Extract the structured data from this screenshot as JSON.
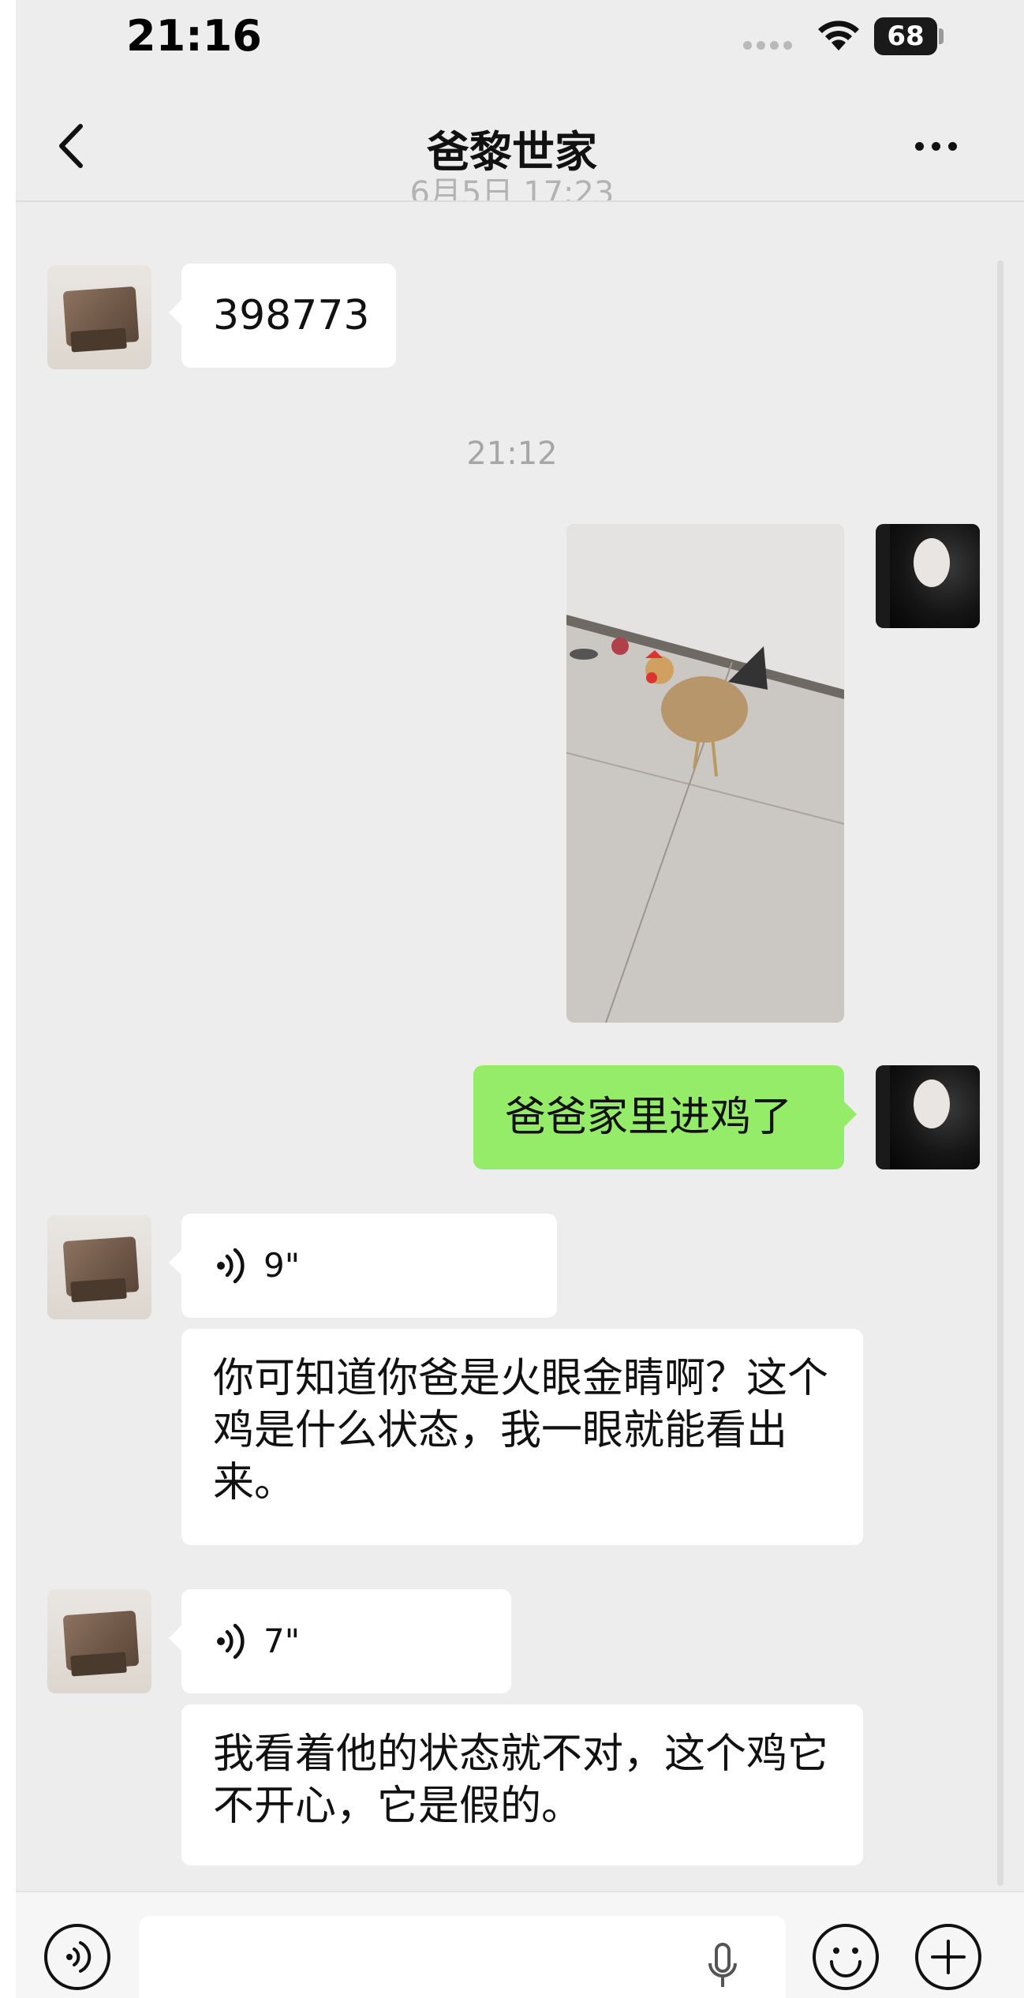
{
  "status_bar": {
    "time": "21:16",
    "battery": "68"
  },
  "nav": {
    "title": "爸黎世家",
    "cut_timestamp": "6月5日 17:23"
  },
  "messages": [
    {
      "from": "them",
      "type": "text",
      "text": "398773"
    },
    {
      "type": "timestamp",
      "text": "21:12"
    },
    {
      "from": "me",
      "type": "image"
    },
    {
      "from": "me",
      "type": "text",
      "text": "爸爸家里进鸡了"
    },
    {
      "from": "them",
      "type": "voice",
      "duration": "9\""
    },
    {
      "from": "them",
      "type": "text",
      "text": "你可知道你爸是火眼金睛啊？这个鸡是什么状态，我一眼就能看出来。"
    },
    {
      "from": "them",
      "type": "voice",
      "duration": "7\""
    },
    {
      "from": "them",
      "type": "text",
      "text": "我看着他的状态就不对，这个鸡它不开心，它是假的。"
    }
  ],
  "colors": {
    "chat_bg": "#ededed",
    "my_bubble": "#95ec69",
    "their_bubble": "#ffffff"
  },
  "icons": [
    "chevron-left-icon",
    "more-icon",
    "wifi-icon",
    "voice-wave-icon",
    "microphone-icon",
    "emoji-icon",
    "plus-icon"
  ]
}
